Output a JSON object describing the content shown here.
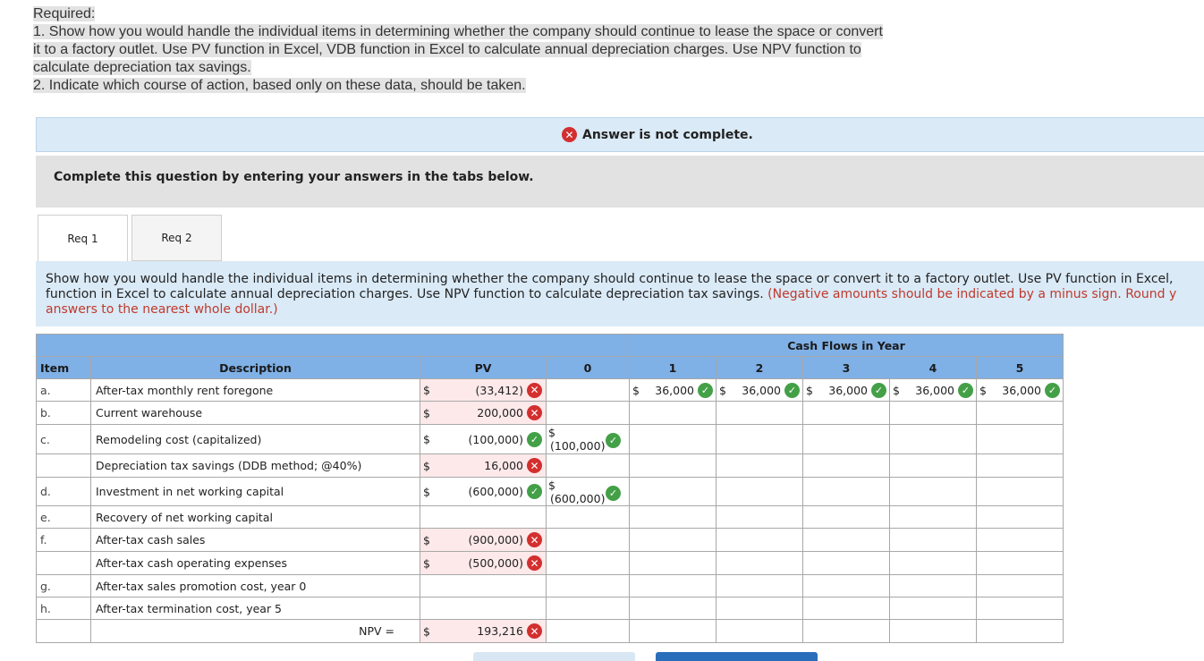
{
  "required": {
    "heading": "Required:",
    "lines": [
      "1. Show how you would handle the individual items in determining whether the company should continue to lease the space or convert",
      "it to a factory outlet. Use PV function in Excel, VDB function in Excel to calculate annual depreciation charges. Use NPV function to",
      "calculate depreciation tax savings.",
      "2. Indicate which course of action, based only on these data, should be taken."
    ]
  },
  "banner": {
    "text": "Answer is not complete."
  },
  "instruction": "Complete this question by entering your answers in the tabs below.",
  "tabs": [
    {
      "label": "Req 1"
    },
    {
      "label": "Req 2"
    }
  ],
  "question": {
    "line1": "Show how you would handle the individual items in determining whether the company should continue to lease the space or convert it to a factory outlet. Use PV function in Excel,",
    "line2": "function in Excel to calculate annual depreciation charges. Use NPV function to calculate depreciation tax savings.",
    "line2_red": "(Negative amounts should be indicated by a minus sign. Round y",
    "line3_red": "answers to the nearest whole dollar.)"
  },
  "table": {
    "group_header": "Cash Flows in Year",
    "headers": {
      "item": "Item",
      "description": "Description",
      "pv": "PV",
      "y0": "0",
      "y1": "1",
      "y2": "2",
      "y3": "3",
      "y4": "4",
      "y5": "5"
    },
    "rows": [
      {
        "item": "a.",
        "desc": "After-tax monthly rent foregone",
        "pv_dollar": "$",
        "pv": "(33,412)",
        "pv_status": "wrong",
        "y1": "36,000",
        "y2": "36,000",
        "y3": "36,000",
        "y4": "36,000",
        "y5": "36,000",
        "dollar": "$"
      },
      {
        "item": "b.",
        "desc": "Current warehouse",
        "pv_dollar": "$",
        "pv": "200,000",
        "pv_status": "wrong"
      },
      {
        "item": "c.",
        "desc": "Remodeling cost (capitalized)",
        "pv_dollar": "$",
        "pv": "(100,000)",
        "pv_status": "correct",
        "y0_dollar": "$",
        "y0": "(100,000)"
      },
      {
        "item": "",
        "desc": "Depreciation tax savings (DDB method; @40%)",
        "pv_dollar": "$",
        "pv": "16,000",
        "pv_status": "wrong"
      },
      {
        "item": "d.",
        "desc": "Investment in net working capital",
        "pv_dollar": "$",
        "pv": "(600,000)",
        "pv_status": "correct",
        "y0_dollar": "$",
        "y0": "(600,000)"
      },
      {
        "item": "e.",
        "desc": "Recovery of net working capital"
      },
      {
        "item": "f.",
        "desc": "After-tax cash sales",
        "pv_dollar": "$",
        "pv": "(900,000)",
        "pv_status": "wrong"
      },
      {
        "item": "",
        "desc": "After-tax cash operating expenses",
        "pv_dollar": "$",
        "pv": "(500,000)",
        "pv_status": "wrong"
      },
      {
        "item": "g.",
        "desc": "After-tax sales promotion cost, year 0"
      },
      {
        "item": "h.",
        "desc": "After-tax termination cost, year 5"
      }
    ],
    "npv": {
      "label": "NPV =",
      "dollar": "$",
      "value": "193,216",
      "status": "wrong"
    }
  },
  "colors": {
    "header_blue": "#7fb0e6",
    "banner_blue": "#daeaf7",
    "wrong_red": "#d32f2f",
    "correct_green": "#43a047",
    "pink": "#fde9ea"
  }
}
